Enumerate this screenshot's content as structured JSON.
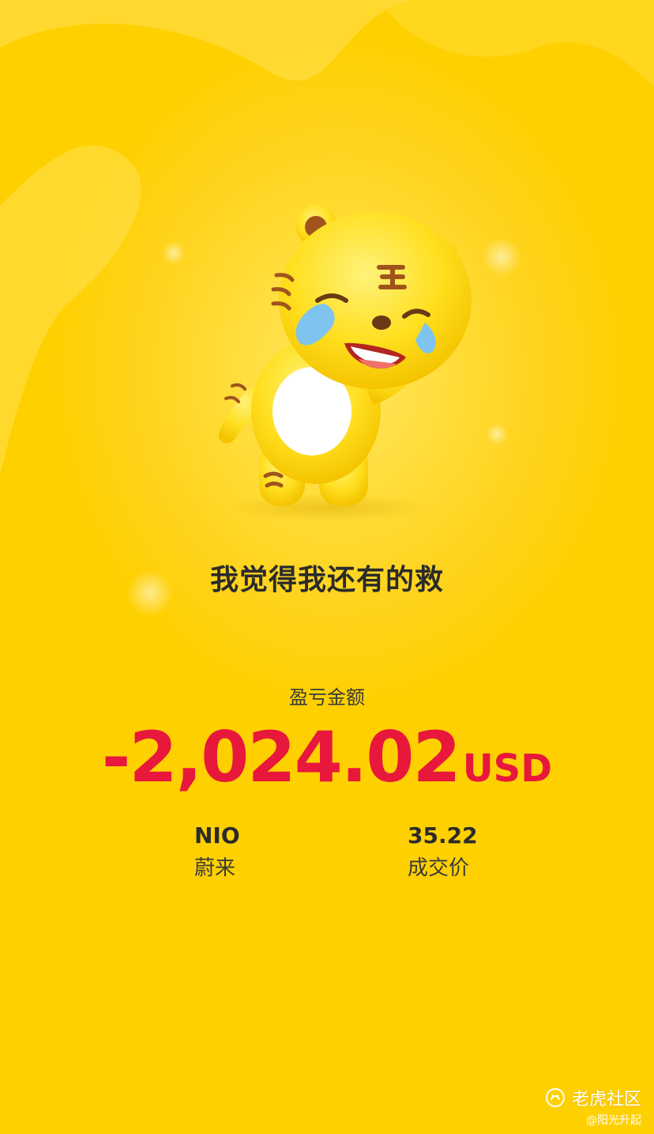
{
  "slogan": "我觉得我还有的救",
  "pnl": {
    "label": "盈亏金额",
    "amount": "-2,024.02",
    "currency": "USD"
  },
  "stock": {
    "symbol": "NIO",
    "name": "蔚来"
  },
  "price": {
    "value": "35.22",
    "label": "成交价"
  },
  "watermark": {
    "brand": "老虎社区",
    "user": "@阳光升起"
  },
  "colors": {
    "background": "#ffd21a",
    "loss": "#e8173c",
    "text": "#2b2b2b"
  },
  "icons": {
    "mascot": "crying-tiger-mascot",
    "brand_logo": "tiger-community-logo-icon"
  }
}
